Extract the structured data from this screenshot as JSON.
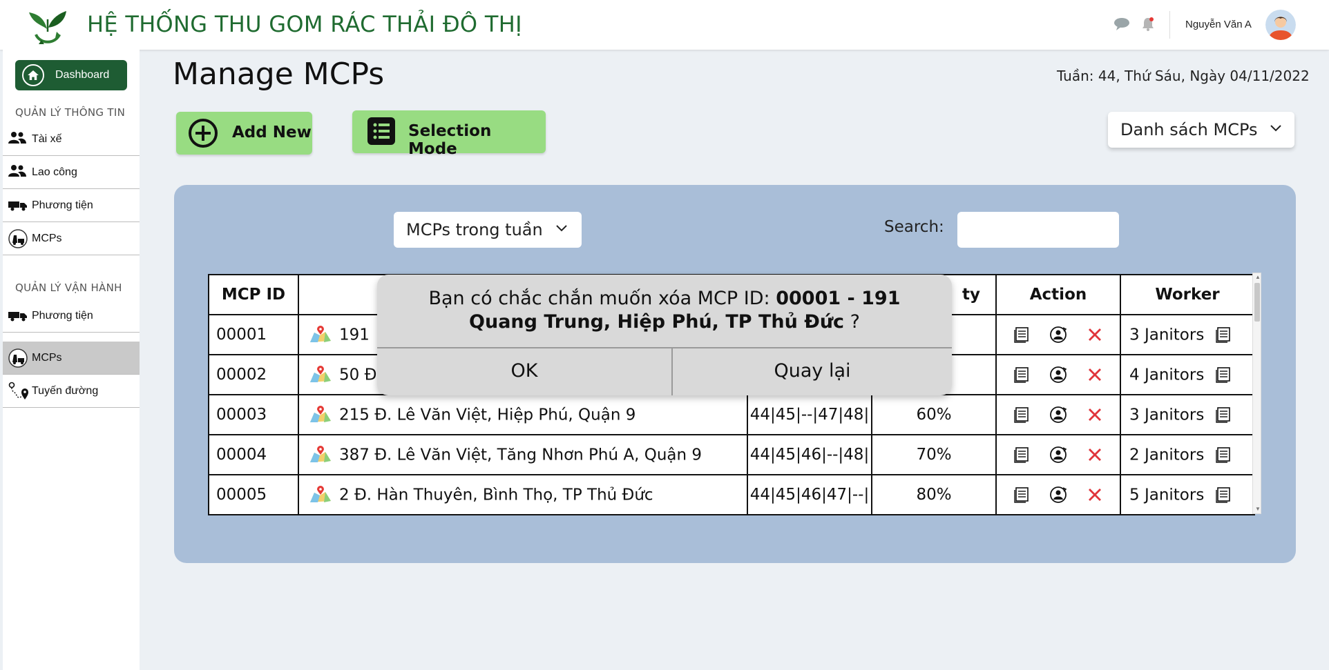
{
  "header": {
    "app_title": "HỆ THỐNG THU GOM RÁC THẢI ĐÔ THỊ",
    "username": "Nguyễn Văn A",
    "colors": {
      "brand_green": "#1f6b30"
    }
  },
  "sidebar": {
    "dashboard_label": "Dashboard",
    "section_info": "QUẢN LÝ THÔNG TIN",
    "info_items": [
      {
        "label": "Tài xế",
        "icon": "users-icon"
      },
      {
        "label": "Lao công",
        "icon": "users-icon"
      },
      {
        "label": "Phương tiện",
        "icon": "truck-icon"
      },
      {
        "label": "MCPs",
        "icon": "mcp-icon"
      }
    ],
    "section_ops": "QUẢN LÝ VẬN HÀNH",
    "ops_items": [
      {
        "label": "Phương tiện",
        "icon": "truck-icon"
      },
      {
        "label": "MCPs",
        "icon": "mcp-icon",
        "active": true
      },
      {
        "label": "Tuyến đường",
        "icon": "route-icon"
      }
    ]
  },
  "main": {
    "page_title": "Manage MCPs",
    "date_line": "Tuần: 44, Thứ Sáu, Ngày 04/11/2022",
    "add_new_label": "Add New",
    "selection_mode_label": "Selection Mode",
    "list_dropdown_label": "Danh sách MCPs",
    "week_dropdown_label": "MCPs trong tuần",
    "search_label": "Search:",
    "search_value": "",
    "colors": {
      "green_button": "#98dc82",
      "panel": "#a9bed8",
      "delete_red": "#e0343a"
    }
  },
  "table": {
    "headers": [
      "MCP ID",
      "",
      "",
      "ty",
      "Action",
      "Worker"
    ],
    "rows": [
      {
        "id": "00001",
        "address": "191",
        "schedule": "",
        "capacity": "",
        "worker": "3 Janitors"
      },
      {
        "id": "00002",
        "address": "50 Đ",
        "schedule": "",
        "capacity": "",
        "worker": "4 Janitors"
      },
      {
        "id": "00003",
        "address": "215 Đ. Lê Văn Việt, Hiệp Phú, Quận 9",
        "schedule": "44|45|--|47|48|",
        "capacity": "60%",
        "worker": "3 Janitors"
      },
      {
        "id": "00004",
        "address": "387 Đ. Lê Văn Việt, Tăng Nhơn Phú A, Quận 9",
        "schedule": "44|45|46|--|48|",
        "capacity": "70%",
        "worker": "2 Janitors"
      },
      {
        "id": "00005",
        "address": "2 Đ. Hàn Thuyên, Bình Thọ, TP Thủ Đức",
        "schedule": "44|45|46|47|--|",
        "capacity": "80%",
        "worker": "5 Janitors"
      }
    ]
  },
  "modal": {
    "message_prefix": "Bạn có chắc chắn muốn xóa MCP ID: ",
    "message_bold_1": "00001 - 191",
    "message_bold_2": "Quang Trung, Hiệp Phú, TP Thủ Đức",
    "message_suffix": " ?",
    "ok_label": "OK",
    "back_label": "Quay lại"
  }
}
